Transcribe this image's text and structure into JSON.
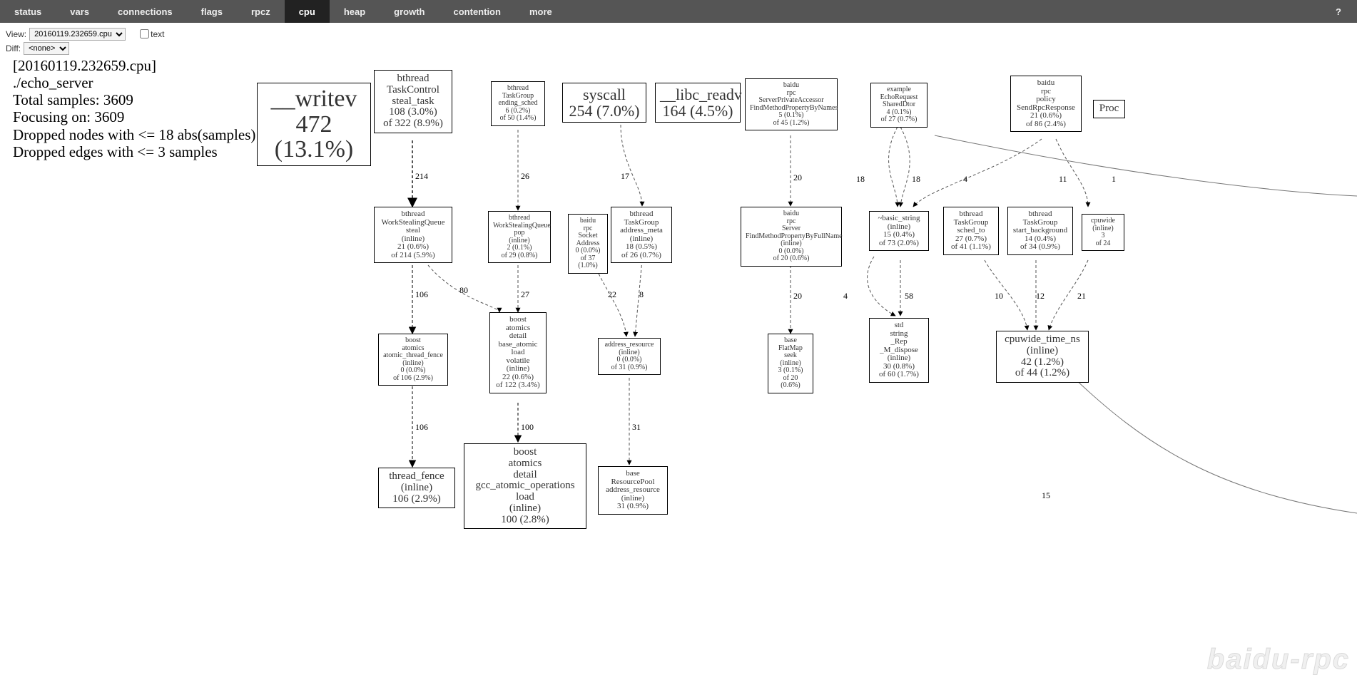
{
  "nav": {
    "items": [
      "status",
      "vars",
      "connections",
      "flags",
      "rpcz",
      "cpu",
      "heap",
      "growth",
      "contention",
      "more"
    ],
    "active": "cpu",
    "help": "?"
  },
  "controls": {
    "view_label": "View:",
    "view_select": "20160119.232659.cpu",
    "text_label": "text",
    "diff_label": "Diff:",
    "diff_select": "<none>"
  },
  "summary": {
    "file": "[20160119.232659.cpu]",
    "binary": "./echo_server",
    "total": "Total samples: 3609",
    "focus": "Focusing on: 3609",
    "drop_nodes": "Dropped nodes with <= 18 abs(samples)",
    "drop_edges": "Dropped edges with <= 3 samples"
  },
  "nodes": {
    "writev": {
      "t": "__writev\n472 (13.1%)"
    },
    "steal_task": {
      "t": "bthread\nTaskControl\nsteal_task\n108 (3.0%)\nof 322 (8.9%)"
    },
    "ending_sched": {
      "t": "bthread\nTaskGroup\nending_sched\n6 (0.2%)\nof 50 (1.4%)"
    },
    "syscall": {
      "t": "syscall\n254 (7.0%)"
    },
    "libc_readv": {
      "t": "__libc_readv\n164 (4.5%)"
    },
    "spa": {
      "t": "baidu\nrpc\nServerPrivateAccessor\nFindMethodPropertyByNames\n5 (0.1%)\nof 45 (1.2%)"
    },
    "echo": {
      "t": "example\nEchoRequest\nSharedDtor\n4 (0.1%)\nof 27 (0.7%)"
    },
    "sendrpc": {
      "t": "baidu\nrpc\npolicy\nSendRpcResponse\n21 (0.6%)\nof 86 (2.4%)"
    },
    "proc": {
      "t": "Proc"
    },
    "wsq_steal": {
      "t": "bthread\nWorkStealingQueue\nsteal\n(inline)\n21 (0.6%)\nof 214 (5.9%)"
    },
    "wsq_pop": {
      "t": "bthread\nWorkStealingQueue\npop\n(inline)\n2 (0.1%)\nof 29 (0.8%)"
    },
    "sock_addr": {
      "t": "baidu\nrpc\nSocket\nAddress\n0 (0.0%)\nof 37 (1.0%)"
    },
    "addr_meta": {
      "t": "bthread\nTaskGroup\naddress_meta\n(inline)\n18 (0.5%)\nof 26 (0.7%)"
    },
    "fmpbfn": {
      "t": "baidu\nrpc\nServer\nFindMethodPropertyByFullName\n(inline)\n0 (0.0%)\nof 20 (0.6%)"
    },
    "basic_str": {
      "t": "~basic_string\n(inline)\n15 (0.4%)\nof 73 (2.0%)"
    },
    "sched_to": {
      "t": "bthread\nTaskGroup\nsched_to\n27 (0.7%)\nof 41 (1.1%)"
    },
    "start_bg": {
      "t": "bthread\nTaskGroup\nstart_background\n14 (0.4%)\nof 34 (0.9%)"
    },
    "cpuwide2": {
      "t": "cpuwide\n(inline)\n3\nof 24"
    },
    "atf": {
      "t": "boost\natomics\natomic_thread_fence\n(inline)\n0 (0.0%)\nof 106 (2.9%)"
    },
    "ba_load": {
      "t": "boost\natomics\ndetail\nbase_atomic\nload\nvolatile\n(inline)\n22 (0.6%)\nof 122 (3.4%)"
    },
    "addr_res": {
      "t": "address_resource\n(inline)\n0 (0.0%)\nof 31 (0.9%)"
    },
    "flatmap": {
      "t": "base\nFlatMap\nseek\n(inline)\n3 (0.1%)\nof 20 (0.6%)"
    },
    "m_dispose": {
      "t": "std\nstring\n_Rep\n_M_dispose\n(inline)\n30 (0.8%)\nof 60 (1.7%)"
    },
    "cpuwide": {
      "t": "cpuwide_time_ns\n(inline)\n42 (1.2%)\nof 44 (1.2%)"
    },
    "thr_fence": {
      "t": "thread_fence\n(inline)\n106 (2.9%)"
    },
    "gcc_ops": {
      "t": "boost\natomics\ndetail\ngcc_atomic_operations\nload\n(inline)\n100 (2.8%)"
    },
    "respool": {
      "t": "base\nResourcePool\naddress_resource\n(inline)\n31 (0.9%)"
    }
  },
  "edge_labels": {
    "e214": "214",
    "e26": "26",
    "e17": "17",
    "e20a": "20",
    "e18a": "18",
    "e18b": "18",
    "e4a": "4",
    "e11": "11",
    "e1": "1",
    "e106a": "106",
    "e80": "80",
    "e27": "27",
    "e22": "22",
    "e8": "8",
    "e20b": "20",
    "e4b": "4",
    "e58": "58",
    "e10": "10",
    "e12": "12",
    "e21": "21",
    "e106b": "106",
    "e100": "100",
    "e31": "31",
    "e15": "15"
  },
  "watermark": "baidu-rpc"
}
